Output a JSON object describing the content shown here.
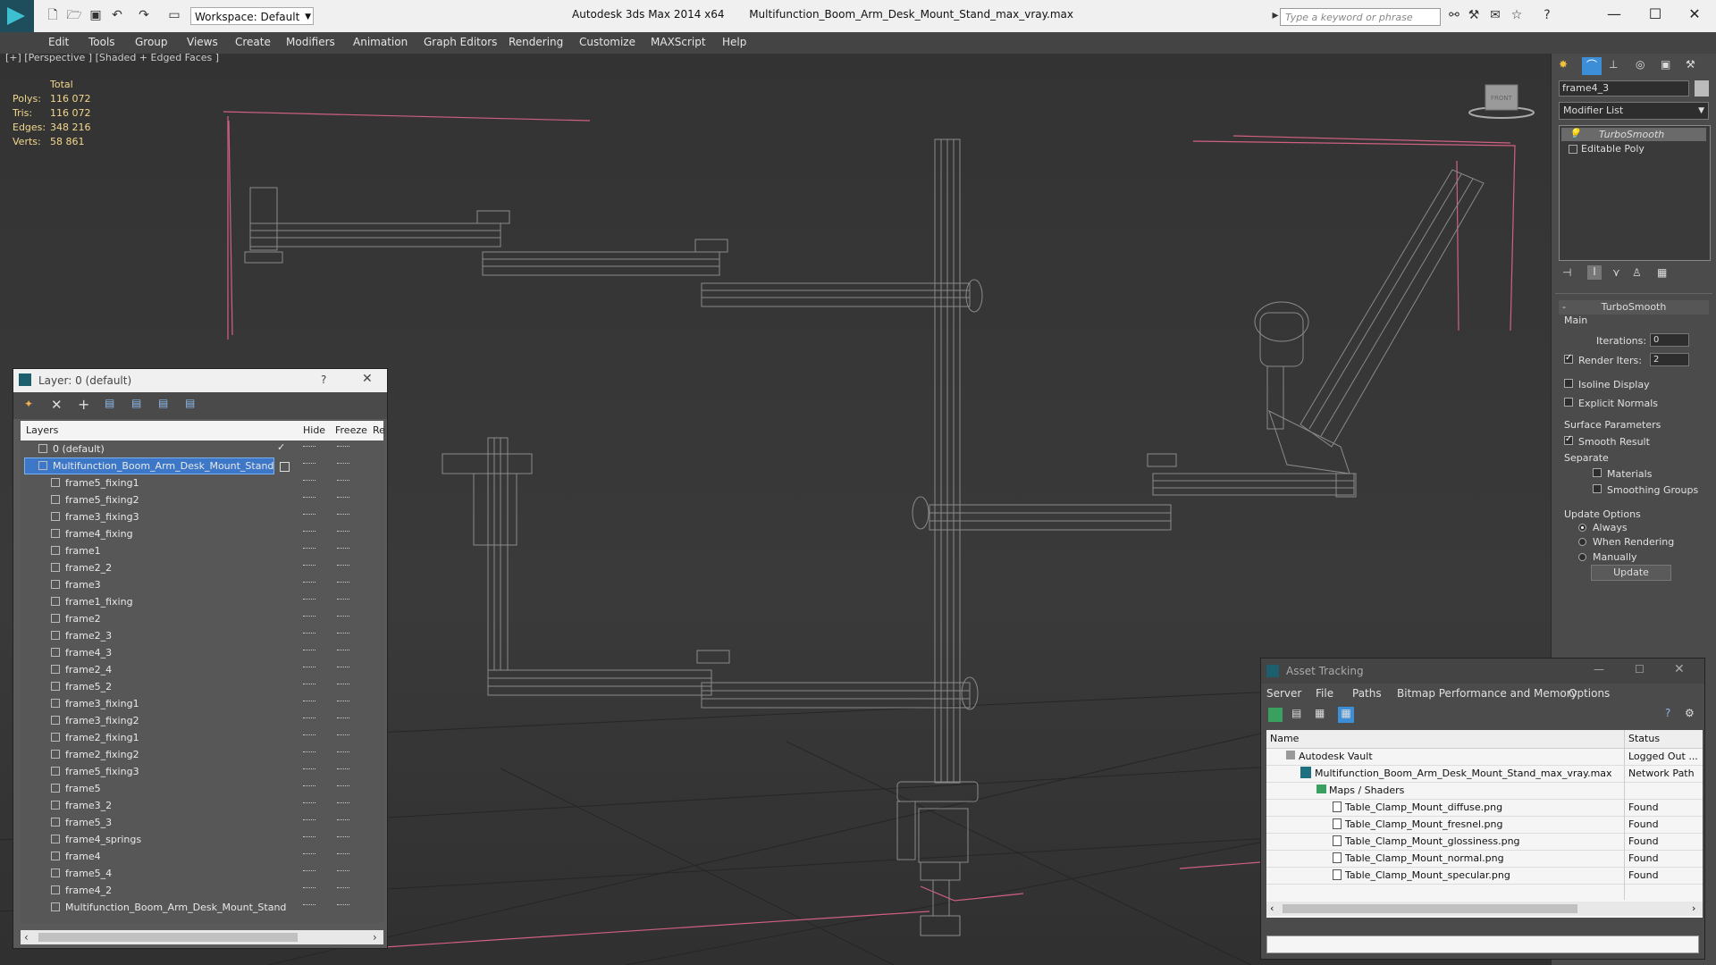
{
  "titlebar": {
    "app": "Autodesk 3ds Max  2014 x64",
    "file": "Multifunction_Boom_Arm_Desk_Mount_Stand_max_vray.max",
    "workspace": "Workspace: Default",
    "search_placeholder": "Type a keyword or phrase"
  },
  "menu": [
    "Edit",
    "Tools",
    "Group",
    "Views",
    "Create",
    "Modifiers",
    "Animation",
    "Graph Editors",
    "Rendering",
    "Customize",
    "MAXScript",
    "Help"
  ],
  "viewport": {
    "label": "[+] [Perspective ] [Shaded + Edged Faces ]",
    "stats": {
      "header": "Total",
      "polys_label": "Polys:",
      "polys": "116 072",
      "tris_label": "Tris:",
      "tris": "116 072",
      "edges_label": "Edges:",
      "edges": "348 216",
      "verts_label": "Verts:",
      "verts": "58 861"
    },
    "viewcube_label": "FRONT"
  },
  "layer_window": {
    "title": "Layer: 0 (default)",
    "help": "?",
    "columns": {
      "layers": "Layers",
      "hide": "Hide",
      "freeze": "Freeze",
      "render": "Re"
    },
    "rows": [
      "0 (default)",
      "Multifunction_Boom_Arm_Desk_Mount_Stand",
      "frame5_fixing1",
      "frame5_fixing2",
      "frame3_fixing3",
      "frame4_fixing",
      "frame1",
      "frame2_2",
      "frame3",
      "frame1_fixing",
      "frame2",
      "frame2_3",
      "frame4_3",
      "frame2_4",
      "frame5_2",
      "frame3_fixing1",
      "frame3_fixing2",
      "frame2_fixing1",
      "frame2_fixing2",
      "frame5_fixing3",
      "frame5",
      "frame3_2",
      "frame5_3",
      "frame4_springs",
      "frame4",
      "frame5_4",
      "frame4_2",
      "Multifunction_Boom_Arm_Desk_Mount_Stand"
    ]
  },
  "command_panel": {
    "object_name": "frame4_3",
    "modifier_list": "Modifier List",
    "stack": [
      "TurboSmooth",
      "Editable Poly"
    ],
    "rollout_title": "TurboSmooth",
    "main_group": "Main",
    "iterations_label": "Iterations:",
    "iterations": "0",
    "render_iters_label": "Render Iters:",
    "render_iters": "2",
    "isoline": "Isoline Display",
    "explicit_normals": "Explicit Normals",
    "surface_params": "Surface Parameters",
    "smooth_result": "Smooth Result",
    "separate": "Separate",
    "materials": "Materials",
    "smoothing_groups": "Smoothing Groups",
    "update_options": "Update Options",
    "always": "Always",
    "when_rendering": "When Rendering",
    "manually": "Manually",
    "update_btn": "Update"
  },
  "asset_tracking": {
    "title": "Asset Tracking",
    "menu": [
      "Server",
      "File",
      "Paths",
      "Bitmap Performance and Memory",
      "Options"
    ],
    "col_name": "Name",
    "col_status": "Status",
    "rows": [
      {
        "name": "Autodesk Vault",
        "status": "Logged Out ...",
        "indent": 0
      },
      {
        "name": "Multifunction_Boom_Arm_Desk_Mount_Stand_max_vray.max",
        "status": "Network Path",
        "indent": 1
      },
      {
        "name": "Maps / Shaders",
        "status": "",
        "indent": 2
      },
      {
        "name": "Table_Clamp_Mount_diffuse.png",
        "status": "Found",
        "indent": 3
      },
      {
        "name": "Table_Clamp_Mount_fresnel.png",
        "status": "Found",
        "indent": 3
      },
      {
        "name": "Table_Clamp_Mount_glossiness.png",
        "status": "Found",
        "indent": 3
      },
      {
        "name": "Table_Clamp_Mount_normal.png",
        "status": "Found",
        "indent": 3
      },
      {
        "name": "Table_Clamp_Mount_specular.png",
        "status": "Found",
        "indent": 3
      }
    ]
  },
  "colors": {
    "accent": "#3c8fd6",
    "selected_row": "#3d78c8",
    "stats_text": "#f2d88c"
  }
}
